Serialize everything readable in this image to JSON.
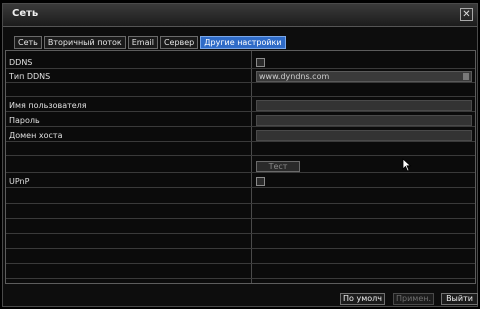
{
  "window": {
    "title": "Сеть"
  },
  "tabs": [
    {
      "label": "Сеть",
      "active": false
    },
    {
      "label": "Вторичный поток",
      "active": false
    },
    {
      "label": "Email",
      "active": false
    },
    {
      "label": "Сервер",
      "active": false
    },
    {
      "label": "Другие настройки",
      "active": true
    }
  ],
  "settings": {
    "ddns": {
      "label": "DDNS",
      "checked": false
    },
    "ddns_type": {
      "label": "Тип DDNS",
      "value": "www.dyndns.com"
    },
    "username": {
      "label": "Имя пользователя",
      "value": ""
    },
    "password": {
      "label": "Пароль",
      "value": ""
    },
    "host_domain": {
      "label": "Домен хоста",
      "value": ""
    },
    "test": {
      "label": "Тест"
    },
    "upnp": {
      "label": "UPnP",
      "checked": false
    }
  },
  "footer": {
    "default_label": "По умолч",
    "apply_label": "Примен.",
    "exit_label": "Выйти"
  },
  "colors": {
    "active_tab": "#2f6bc7",
    "background": "#0b0b0b"
  }
}
